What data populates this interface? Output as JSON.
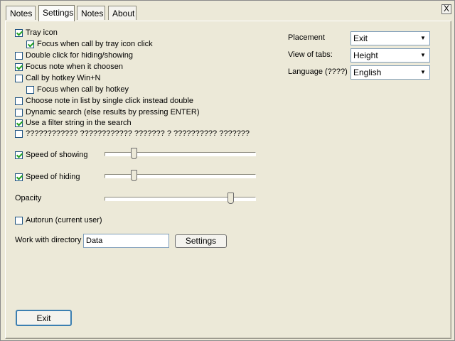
{
  "tabs": [
    {
      "label": "Notes"
    },
    {
      "label": "Settings"
    },
    {
      "label": "Notes"
    },
    {
      "label": "About"
    }
  ],
  "close_label": "X",
  "options": [
    {
      "label": "Tray icon",
      "checked": true
    },
    {
      "label": "Focus when call by tray icon click",
      "checked": true
    },
    {
      "label": "Double click for hiding/showing",
      "checked": false
    },
    {
      "label": "Focus note when it choosen",
      "checked": true
    },
    {
      "label": "Call by hotkey Win+N",
      "checked": false
    },
    {
      "label": "Focus when call by hotkey",
      "checked": false
    },
    {
      "label": "Choose note in list by single click instead double",
      "checked": false
    },
    {
      "label": "Dynamic search (else results by pressing ENTER)",
      "checked": false
    },
    {
      "label": "Use a filter string in the search",
      "checked": true
    },
    {
      "label": "???????????? ???????????? ??????? ? ?????????? ???????",
      "checked": false
    }
  ],
  "speed_showing": {
    "label": "Speed of showing",
    "checked": true,
    "value": 0.18
  },
  "speed_hiding": {
    "label": "Speed of hiding",
    "checked": true,
    "value": 0.18
  },
  "opacity": {
    "label": "Opacity",
    "value": 0.85
  },
  "autorun": {
    "label": "Autorun (current user)",
    "checked": false
  },
  "directory": {
    "label": "Work with directory",
    "value": "Data",
    "settings_button": "Settings"
  },
  "right_settings": [
    {
      "label": "Placement",
      "value": "Exit"
    },
    {
      "label": "View of tabs:",
      "value": "Height"
    },
    {
      "label": "Language (????)",
      "value": "English"
    }
  ],
  "exit_button": "Exit"
}
